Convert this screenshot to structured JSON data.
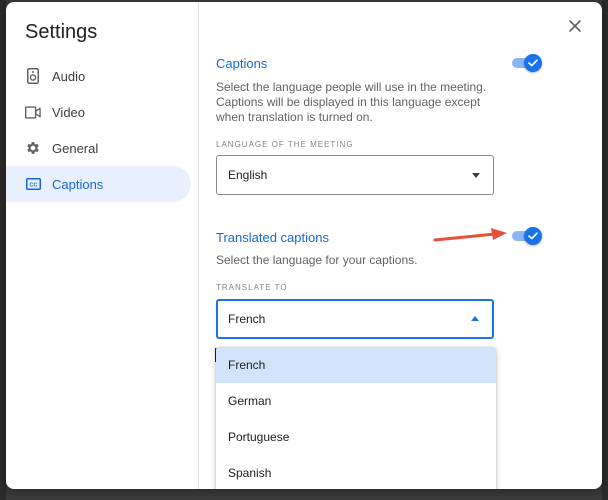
{
  "dialog": {
    "title": "Settings"
  },
  "sidebar": {
    "items": [
      {
        "label": "Audio",
        "icon": "speaker-icon",
        "active": false
      },
      {
        "label": "Video",
        "icon": "video-camera-icon",
        "active": false
      },
      {
        "label": "General",
        "icon": "gear-icon",
        "active": false
      },
      {
        "label": "Captions",
        "icon": "closed-captions-icon",
        "active": true
      }
    ]
  },
  "captions": {
    "title": "Captions",
    "enabled": true,
    "description": "Select the language people will use in the meeting. Captions will be displayed in this language except when translation is turned on.",
    "field_label": "LANGUAGE OF THE MEETING",
    "selected": "English"
  },
  "translated": {
    "title": "Translated captions",
    "enabled": true,
    "description": "Select the language for your captions.",
    "field_label": "TRANSLATE TO",
    "selected": "French",
    "options": [
      "French",
      "German",
      "Portuguese",
      "Spanish"
    ]
  },
  "colors": {
    "accent": "#1a73e8",
    "accent_text": "#1967d2",
    "active_nav_bg": "#e8f0fe",
    "selected_option_bg": "#d2e3fc",
    "annotation_arrow": "#e8503a"
  }
}
